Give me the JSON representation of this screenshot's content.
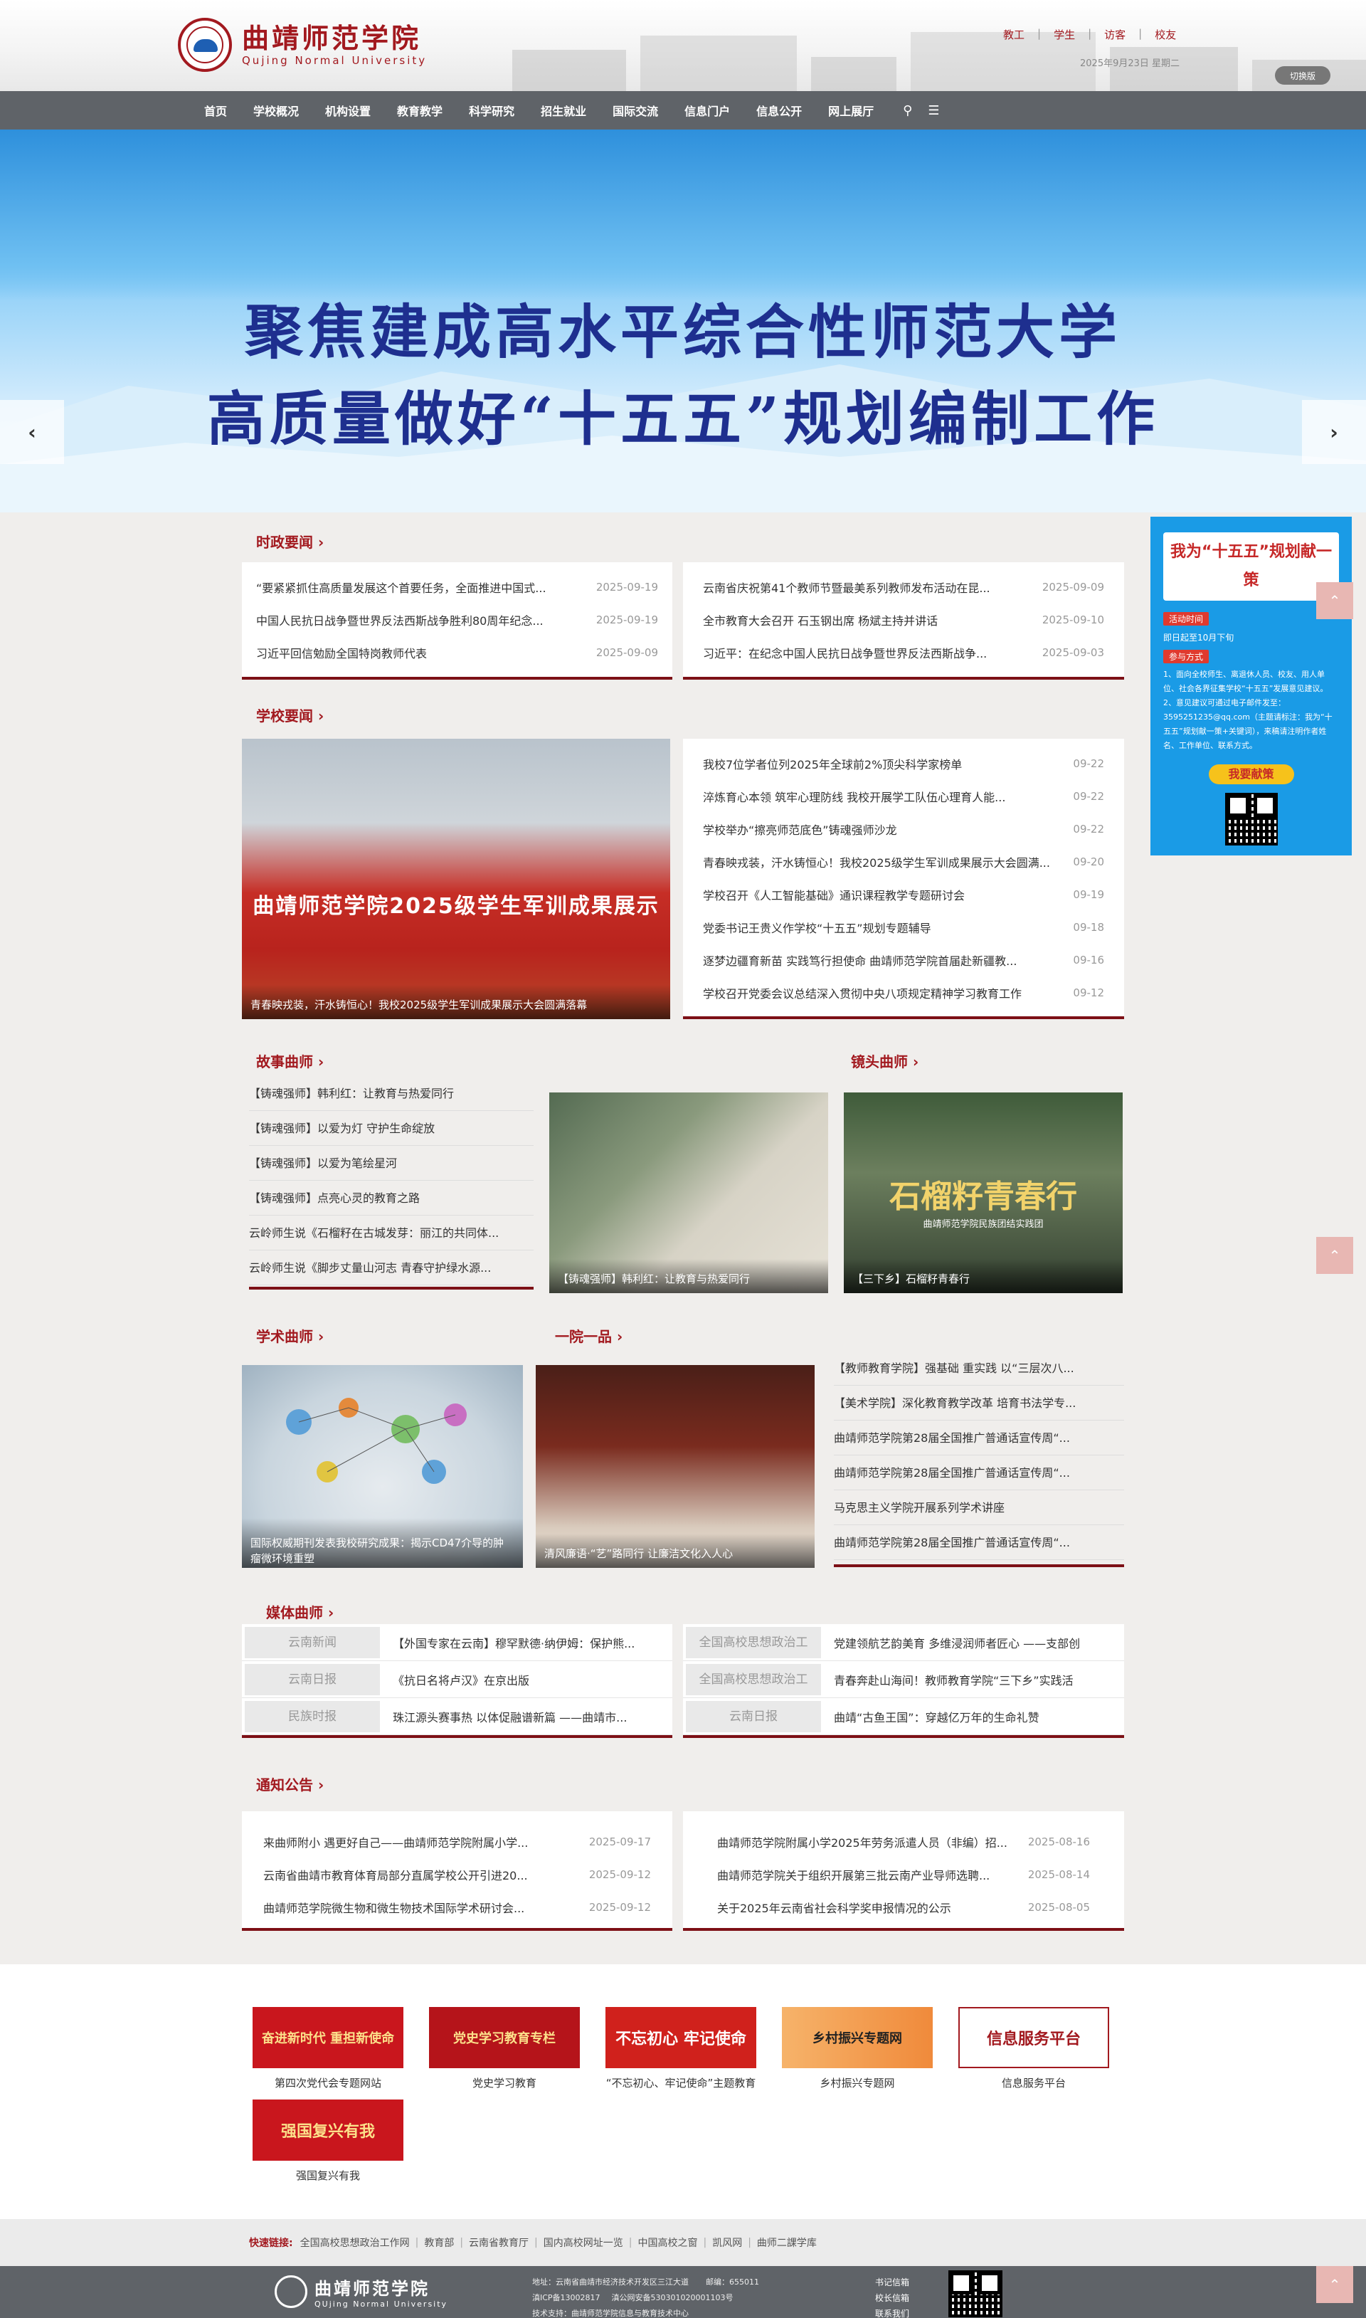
{
  "header": {
    "logo_cn": "曲靖师范学院",
    "logo_en": "Qujing Normal University",
    "links": [
      "教工",
      "学生",
      "访客",
      "校友"
    ],
    "date": "2025年9月23日 星期二",
    "switch_label": "切换版"
  },
  "nav": {
    "items": [
      "首页",
      "学校概况",
      "机构设置",
      "教育教学",
      "科学研究",
      "招生就业",
      "国际交流",
      "信息门户",
      "信息公开",
      "网上展厅"
    ]
  },
  "banner": {
    "line1": "聚焦建成高水平综合性师范大学",
    "line2": "高质量做好“十五五”规划编制工作",
    "slide_count": 6,
    "active_slide": 1
  },
  "politics": {
    "title": "时政要闻",
    "left": [
      {
        "t": "“要紧紧抓住高质量发展这个首要任务，全面推进中国式...",
        "d": "2025-09-19"
      },
      {
        "t": "中国人民抗日战争暨世界反法西斯战争胜利80周年纪念...",
        "d": "2025-09-19"
      },
      {
        "t": "习近平回信勉励全国特岗教师代表",
        "d": "2025-09-09"
      }
    ],
    "right": [
      {
        "t": "云南省庆祝第41个教师节暨最美系列教师发布活动在昆...",
        "d": "2025-09-09"
      },
      {
        "t": "全市教育大会召开 石玉钢出席 杨斌主持并讲话",
        "d": "2025-09-10"
      },
      {
        "t": "习近平：在纪念中国人民抗日战争暨世界反法西斯战争...",
        "d": "2025-09-03"
      }
    ]
  },
  "school_news": {
    "title": "学校要闻",
    "photo_caption": "青春映戎装，汗水铸恒心！我校2025级学生军训成果展示大会圆满落幕",
    "photo_banner": "曲靖师范学院2025级学生军训成果展示",
    "items": [
      {
        "t": "我校7位学者位列2025年全球前2%顶尖科学家榜单",
        "d": "09-22"
      },
      {
        "t": "淬炼育心本领 筑牢心理防线 我校开展学工队伍心理育人能...",
        "d": "09-22"
      },
      {
        "t": "学校举办“擦亮师范底色”铸魂强师沙龙",
        "d": "09-22"
      },
      {
        "t": "青春映戎装，汗水铸恒心！我校2025级学生军训成果展示大会圆满...",
        "d": "09-20"
      },
      {
        "t": "学校召开《人工智能基础》通识课程教学专题研讨会",
        "d": "09-19"
      },
      {
        "t": "党委书记王贵义作学校“十五五”规划专题辅导",
        "d": "09-18"
      },
      {
        "t": "逐梦边疆育新苗 实践笃行担使命 曲靖师范学院首届赴新疆教...",
        "d": "09-16"
      },
      {
        "t": "学校召开党委会议总结深入贯彻中央八项规定精神学习教育工作",
        "d": "09-12"
      }
    ]
  },
  "stories": {
    "title": "故事曲师",
    "items": [
      "【铸魂强师】韩利红：让教育与热爱同行",
      "【铸魂强师】以爱为灯 守护生命绽放",
      "【铸魂强师】以爱为笔绘星河",
      "【铸魂强师】点亮心灵的教育之路",
      "云岭师生说《石榴籽在古城发芽：丽江的共同体...",
      "云岭师生说《脚步丈量山河志 青春守护绿水源..."
    ],
    "photo_caption": "【铸魂强师】韩利红：让教育与热爱同行"
  },
  "lens": {
    "title": "镜头曲师",
    "photo_caption": "【三下乡】石榴籽青春行",
    "photo_text": "石榴籽青春行",
    "photo_sub": "曲靖师范学院民族团结实践团"
  },
  "academic": {
    "title": "学术曲师",
    "photo_caption": "国际权威期刊发表我校研究成果：揭示CD47介导的肿瘤微环境重塑"
  },
  "college": {
    "title": "一院一品",
    "photo_caption": "清风廉语·“艺”路同行 让廉洁文化入人心",
    "items": [
      "【教师教育学院】强基础 重实践 以“三层次八...",
      "【美术学院】深化教育教学改革 培育书法学专...",
      "曲靖师范学院第28届全国推广普通话宣传周“...",
      "曲靖师范学院第28届全国推广普通话宣传周“...",
      "马克思主义学院开展系列学术讲座",
      "曲靖师范学院第28届全国推广普通话宣传周“..."
    ]
  },
  "media": {
    "title": "媒体曲师",
    "left": [
      {
        "src": "云南新闻",
        "t": "【外国专家在云南】穆罕默德·纳伊姆：保护熊..."
      },
      {
        "src": "云南日报",
        "t": "《抗日名将卢汉》在京出版"
      },
      {
        "src": "民族时报",
        "t": "珠江源头赛事热 以体促融谱新篇 ——曲靖市..."
      }
    ],
    "right": [
      {
        "src": "全国高校思想政治工",
        "t": "党建领航艺韵美育 多维浸润师者匠心 ——支部创"
      },
      {
        "src": "全国高校思想政治工",
        "t": "青春奔赴山海间！教师教育学院“三下乡”实践活"
      },
      {
        "src": "云南日报",
        "t": "曲靖“古鱼王国”：穿越亿万年的生命礼赞"
      }
    ]
  },
  "notices": {
    "title": "通知公告",
    "left": [
      {
        "t": "来曲师附小 遇更好自己——曲靖师范学院附属小学...",
        "d": "2025-09-17"
      },
      {
        "t": "云南省曲靖市教育体育局部分直属学校公开引进20...",
        "d": "2025-09-12"
      },
      {
        "t": "曲靖师范学院微生物和微生物技术国际学术研讨会...",
        "d": "2025-09-12"
      }
    ],
    "right": [
      {
        "t": "曲靖师范学院附属小学2025年劳务派遣人员（非编）招...",
        "d": "2025-08-16"
      },
      {
        "t": "曲靖师范学院关于组织开展第三批云南产业导师选聘...",
        "d": "2025-08-14"
      },
      {
        "t": "关于2025年云南省社会科学奖申报情况的公示",
        "d": "2025-08-05"
      }
    ]
  },
  "side_ad": {
    "title": "我为“十五五”规划献一策",
    "chip1": "活动时间",
    "time": "即日起至10月下旬",
    "chip2": "参与方式",
    "text": "1、面向全校师生、离退休人员、校友、用人单位、社会各界征集学校“十五五”发展意见建议。 2、意见建议可通过电子邮件发至：3595251235@qq.com（主题请标注：我为“十五五”规划献一策+关键词），来稿请注明作者姓名、工作单位、联系方式。",
    "button": "我要献策"
  },
  "links": [
    {
      "cap": "第四次党代会专题网站",
      "img": "奋进新时代 重担新使命",
      "color": "#c9161d"
    },
    {
      "cap": "党史学习教育",
      "img": "党史学习教育专栏",
      "color": "#b5141a"
    },
    {
      "cap": "“不忘初心、牢记使命”主题教育",
      "img": "不忘初心 牢记使命",
      "color": "#d0211c"
    },
    {
      "cap": "乡村振兴专题网",
      "img": "乡村振兴专题网",
      "color": "#f39c4c"
    },
    {
      "cap": "信息服务平台",
      "img": "信息服务平台",
      "color": "#ffffff"
    },
    {
      "cap": "强国复兴有我",
      "img": "强国复兴有我",
      "color": "#c9161d"
    }
  ],
  "quick": {
    "label": "快速链接:",
    "items": [
      "全国高校思想政治工作网",
      "教育部",
      "云南省教育厅",
      "国内高校网址一览",
      "中国高校之窗",
      "凯风网",
      "曲师二課学库"
    ]
  },
  "footer": {
    "logo_cn": "曲靖师范学院",
    "logo_en": "QUjing Normal University",
    "address": "地址：云南省曲靖市经济技术开发区三江大道",
    "zip": "邮编：655011",
    "icp": "滇ICP备13002817",
    "police": "滇公网安备530301020001103号",
    "support": "技术支持：曲靖师范学院信息与教育技术中心",
    "links": [
      "书记信箱",
      "校长信箱",
      "联系我们"
    ]
  }
}
